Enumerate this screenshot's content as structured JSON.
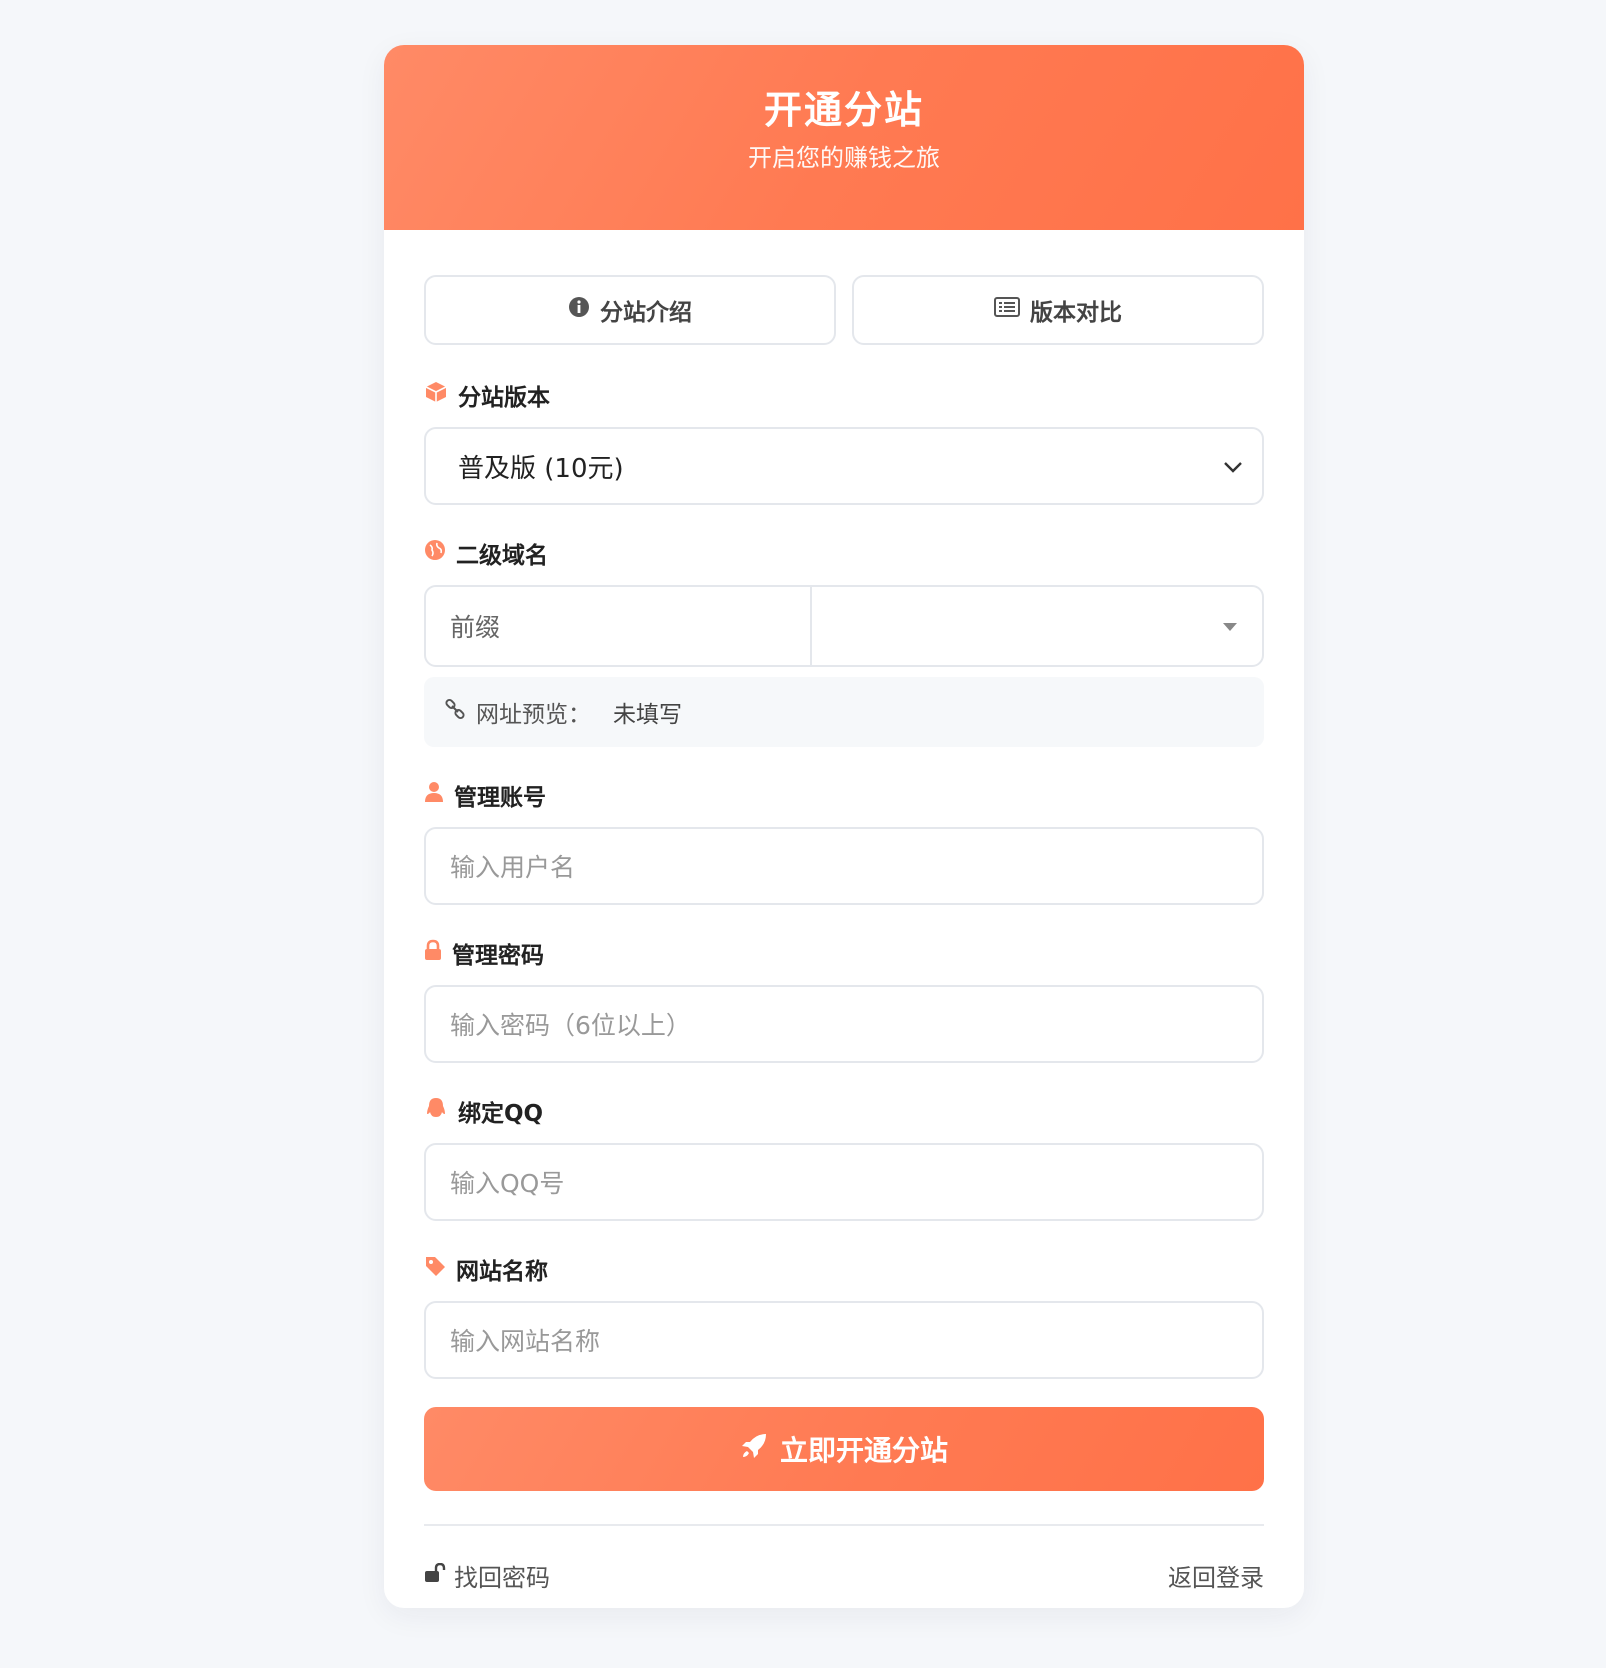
{
  "header": {
    "title": "开通分站",
    "subtitle": "开启您的赚钱之旅"
  },
  "top_buttons": {
    "intro_label": "分站介绍",
    "compare_label": "版本对比"
  },
  "fields": {
    "version": {
      "label": "分站版本",
      "value": "普及版 (10元)"
    },
    "domain": {
      "label": "二级域名",
      "prefix_placeholder": "前缀",
      "suffix_value": ""
    },
    "preview": {
      "label": "网址预览：",
      "value": "未填写"
    },
    "account": {
      "label": "管理账号",
      "placeholder": "输入用户名"
    },
    "password": {
      "label": "管理密码",
      "placeholder": "输入密码（6位以上）"
    },
    "qq": {
      "label": "绑定QQ",
      "placeholder": "输入QQ号"
    },
    "site_name": {
      "label": "网站名称",
      "placeholder": "输入网站名称"
    }
  },
  "submit_label": "立即开通分站",
  "footer": {
    "forgot_label": "找回密码",
    "back_label": "返回登录"
  },
  "colors": {
    "accent": "#ff7a52",
    "accent_light": "#ff8a66"
  }
}
